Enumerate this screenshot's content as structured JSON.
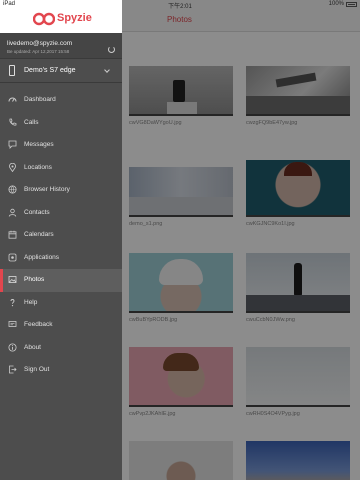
{
  "status_bar": {
    "carrier": "iPad",
    "time": "下午2:01",
    "battery": "100%"
  },
  "brand": {
    "name": "Spyzie"
  },
  "account": {
    "email": "livedemo@spyzie.com",
    "sync_info": "Be updated:  Apr 12,2017 15:58"
  },
  "device": {
    "name": "Demo's S7 edge"
  },
  "menu": {
    "items": [
      {
        "label": "Dashboard",
        "icon": "dashboard-icon"
      },
      {
        "label": "Calls",
        "icon": "phone-icon"
      },
      {
        "label": "Messages",
        "icon": "message-icon"
      },
      {
        "label": "Locations",
        "icon": "location-pin-icon"
      },
      {
        "label": "Browser History",
        "icon": "globe-icon"
      },
      {
        "label": "Contacts",
        "icon": "contact-icon"
      },
      {
        "label": "Calendars",
        "icon": "calendar-icon"
      },
      {
        "label": "Applications",
        "icon": "applications-icon"
      },
      {
        "label": "Photos",
        "icon": "photo-icon",
        "active": true
      },
      {
        "label": "Help",
        "icon": "help-icon"
      },
      {
        "label": "Feedback",
        "icon": "feedback-icon"
      },
      {
        "label": "About",
        "icon": "info-icon"
      },
      {
        "label": "Sign Out",
        "icon": "sign-out-icon"
      }
    ]
  },
  "main": {
    "title": "Photos",
    "photos": [
      {
        "filename": "cwVG8DaWYgoU.jpg"
      },
      {
        "filename": "cwzgFQ9bE47yw.jpg"
      },
      {
        "filename": "demo_s1.png"
      },
      {
        "filename": "cwKGJNC9Ko1I.jpg"
      },
      {
        "filename": "cwBuBYpRODB.jpg"
      },
      {
        "filename": "cwuCcbN0JWw.png"
      },
      {
        "filename": "cwPvp2JKAhIE.jpg"
      },
      {
        "filename": "cwRH0S4O4VPyg.jpg"
      },
      {
        "filename": ""
      },
      {
        "filename": ""
      }
    ]
  },
  "colors": {
    "accent": "#e2464e",
    "drawer": "#4d4d4d",
    "active_item": "#5e5e5e"
  }
}
